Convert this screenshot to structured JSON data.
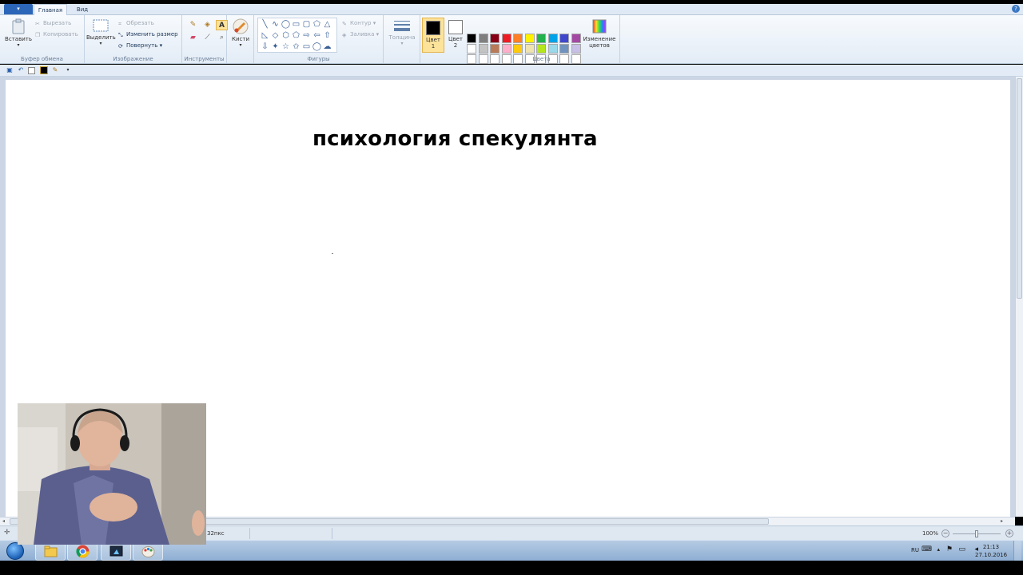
{
  "ribbon": {
    "app_menu_label": "▾",
    "tabs": [
      {
        "label": "Главная",
        "active": true
      },
      {
        "label": "Вид",
        "active": false
      }
    ],
    "clipboard": {
      "paste": "Вставить",
      "cut": "Вырезать",
      "copy": "Копировать",
      "group_label": "Буфер обмена"
    },
    "image": {
      "select": "Выделить",
      "crop": "Обрезать",
      "resize": "Изменить размер",
      "rotate": "Повернуть",
      "group_label": "Изображение"
    },
    "tools": {
      "group_label": "Инструменты",
      "items": [
        "pencil-icon",
        "fill-icon",
        "text-icon",
        "eraser-icon",
        "color-picker-icon",
        "magnifier-icon"
      ]
    },
    "brushes": {
      "label": "Кисти"
    },
    "shapes": {
      "group_label": "Фигуры",
      "outline": "Контур",
      "fill": "Заливка",
      "glyphs": [
        "╲",
        "∿",
        "◯",
        "▭",
        "▢",
        "⬠",
        "△",
        "◺",
        "◇",
        "⬡",
        "⬠",
        "⇨",
        "⇦",
        "⇧",
        "⇩",
        "✦",
        "☆",
        "✩",
        "▭",
        "◯",
        "☁"
      ]
    },
    "thickness": {
      "label": "Толщина"
    },
    "color1": {
      "label": "Цвет",
      "sub": "1",
      "value": "#000000"
    },
    "color2": {
      "label": "Цвет",
      "sub": "2",
      "value": "#ffffff"
    },
    "colors_group_label": "Цвета",
    "edit_colors": {
      "label": "Изменение цветов"
    },
    "palette": [
      "#000000",
      "#7f7f7f",
      "#880015",
      "#ed1c24",
      "#ff7f27",
      "#fff200",
      "#22b14c",
      "#00a2e8",
      "#3f48cc",
      "#a349a4",
      "#ffffff",
      "#c3c3c3",
      "#b97a57",
      "#ffaec9",
      "#ffc90e",
      "#efe4b0",
      "#b5e61d",
      "#99d9ea",
      "#7092be",
      "#c8bfe7",
      "#ffffff",
      "#ffffff",
      "#ffffff",
      "#ffffff",
      "#ffffff",
      "#ffffff",
      "#ffffff",
      "#ffffff",
      "#ffffff",
      "#ffffff"
    ]
  },
  "canvas": {
    "text": "психология спекулянта"
  },
  "status": {
    "size_text": "32пкс",
    "zoom": "100%"
  },
  "taskbar": {
    "language": "RU",
    "time": "21:13",
    "date": "27.10.2016"
  }
}
